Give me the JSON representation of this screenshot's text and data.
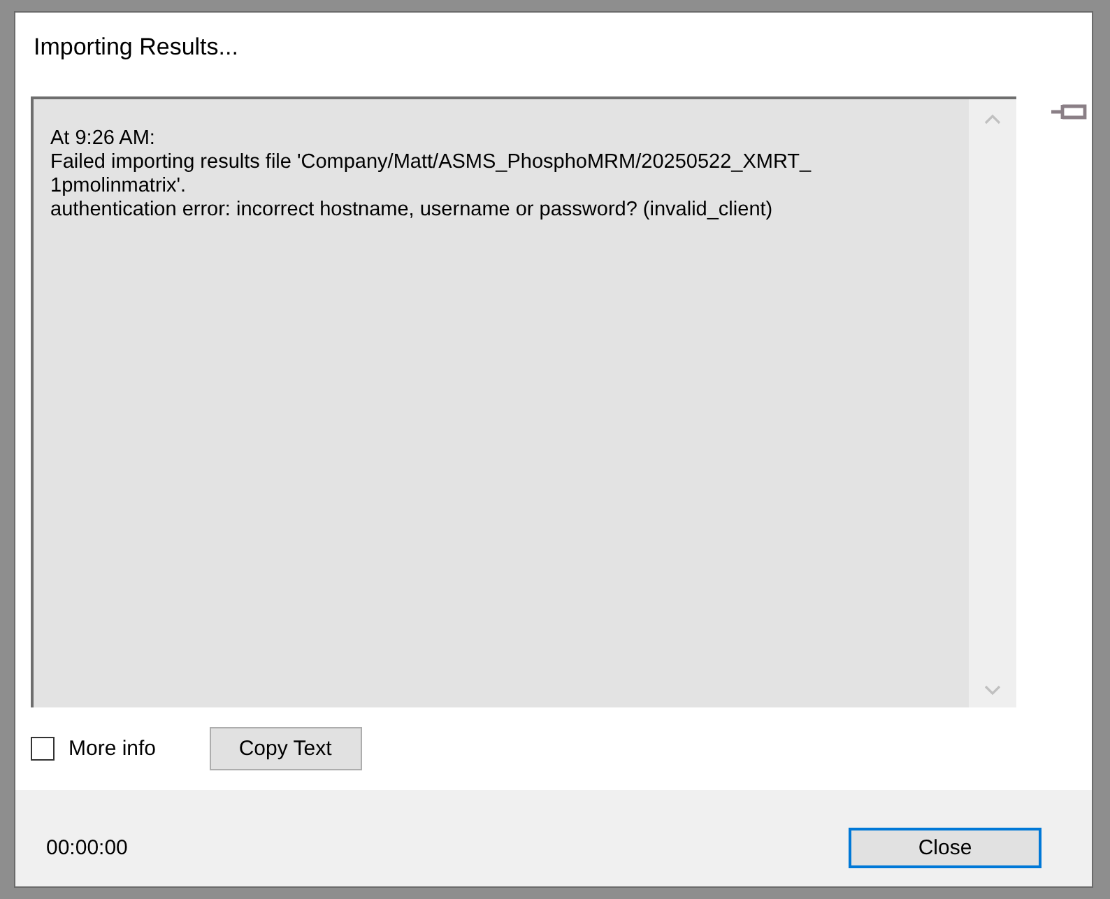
{
  "window": {
    "title": "Importing Results..."
  },
  "message": {
    "lines": [
      "At 9:26 AM:",
      "Failed importing results file 'Company/Matt/ASMS_PhosphoMRM/20250522_XMRT_",
      "1pmolinmatrix'.",
      "authentication error: incorrect hostname, username or password? (invalid_client)"
    ]
  },
  "more_info": {
    "label": "More info",
    "checked": false
  },
  "copy_button": {
    "label": "Copy Text"
  },
  "footer": {
    "elapsed": "00:00:00",
    "close_button": {
      "label": "Close",
      "focused": true
    }
  }
}
